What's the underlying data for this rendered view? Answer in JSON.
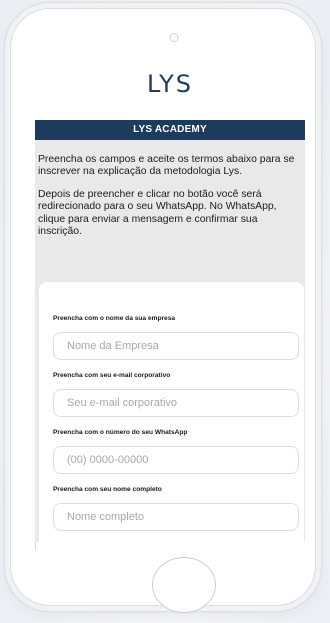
{
  "logo": {
    "text": "LYS"
  },
  "banner": {
    "title": "LYS ACADEMY"
  },
  "intro": {
    "paragraph1": "Preencha os campos e aceite os termos abaixo para se inscrever na explicação da metodologia Lys.",
    "paragraph2": "Depois de preencher e clicar no botão você será redirecionado para o seu WhatsApp. No WhatsApp, clique para enviar a mensagem e confirmar sua inscrição."
  },
  "form": {
    "company": {
      "label": "Preencha com o nome da sua empresa",
      "placeholder": "Nome da Empresa",
      "value": ""
    },
    "email": {
      "label": "Preencha com seu e-mail corporativo",
      "placeholder": "Seu e-mail corporativo",
      "value": ""
    },
    "whatsapp": {
      "label": "Preencha com o número do seu WhatsApp",
      "placeholder": "(00) 0000-00000",
      "value": ""
    },
    "name": {
      "label": "Preencha com seu nome completo",
      "placeholder": "Nome completo",
      "value": ""
    }
  },
  "colors": {
    "brand_navy": "#1d3b5c",
    "intro_background": "#e9e9ea",
    "input_border": "#dadde1",
    "placeholder": "#a4a8ad"
  }
}
